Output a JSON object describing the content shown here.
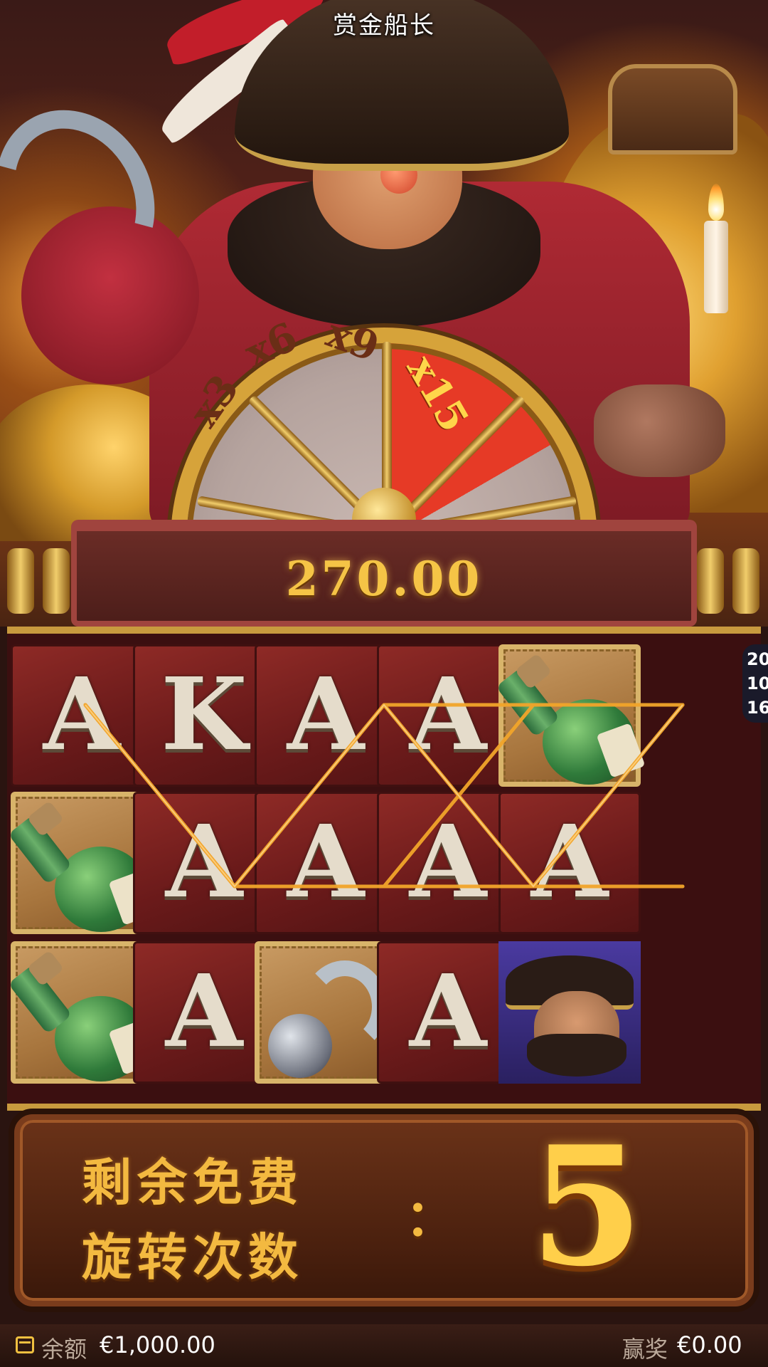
{
  "game": {
    "title": "赏金船长"
  },
  "wheel": {
    "multipliers": [
      {
        "label": "x3",
        "highlighted": false
      },
      {
        "label": "x6",
        "highlighted": false
      },
      {
        "label": "x9",
        "highlighted": false
      },
      {
        "label": "x15",
        "highlighted": true
      }
    ]
  },
  "win_display": {
    "value": "270.00"
  },
  "side_info": [
    "20",
    "10",
    "16"
  ],
  "reels": {
    "rows": [
      [
        "A",
        "K",
        "A",
        "A",
        "rum-bottle"
      ],
      [
        "rum-bottle",
        "A",
        "A",
        "A",
        "A"
      ],
      [
        "rum-bottle",
        "A",
        "hook",
        "A",
        "pirate-captain"
      ]
    ]
  },
  "free_spins": {
    "label_line1": "剩余免费",
    "label_line2": "旋转次数",
    "separator": "：",
    "remaining": "5"
  },
  "footer": {
    "balance_label": "余额",
    "balance_value": "€1,000.00",
    "win_label": "赢奖",
    "win_value": "€0.00"
  },
  "colors": {
    "accent_gold": "#f3b940",
    "payline": "#f2a52a",
    "reel_red": "#8e2a26",
    "wheel_hot": "#e63a26"
  }
}
